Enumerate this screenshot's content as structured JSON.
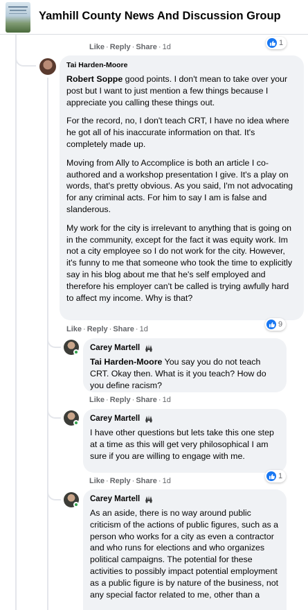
{
  "header": {
    "group_title": "Yamhill County News And Discussion Group"
  },
  "actions": {
    "like": "Like",
    "reply": "Reply",
    "share": "Share",
    "separator": "·"
  },
  "top_row": {
    "time": "1d",
    "reactions": "1"
  },
  "comment_main": {
    "author": "Tai Harden-Moore",
    "mention": "Robert Soppe",
    "paragraph_1": " good points. I don't mean to take over your post but I want to just mention a few things because I appreciate you calling these things out.",
    "paragraph_2": "For the record, no, I don't teach CRT, I have no idea where he got all of his inaccurate information on that. It's completely made up.",
    "paragraph_3": "Moving from Ally to Accomplice is both an article I co-authored and a workshop presentation I give. It's a play on words, that's pretty obvious. As you said, I'm not advocating for any criminal acts. For him to say I am is false and slanderous.",
    "paragraph_4": "My work for the city is irrelevant to anything that is going on in the community, except for the fact it was equity work. Im not a city employee so I do not work for the city. However, it's funny to me that someone who took the time to explicitly say in his blog about me that he's self employed and therefore his employer can't be called is trying awfully hard to affect my income. Why is that?",
    "time": "1d",
    "reactions": "9"
  },
  "reply_1": {
    "author": "Carey Martell",
    "mention": "Tai Harden-Moore",
    "text": " You say you do not teach CRT. Okay then. What is it you teach? How do you define racism?",
    "time": "1d"
  },
  "reply_2": {
    "author": "Carey Martell",
    "text": "I have other questions but lets take this one step at a time as this will get very philosophical I am sure if you are willing to engage with me.",
    "time": "1d",
    "reactions": "1"
  },
  "reply_3": {
    "author": "Carey Martell",
    "text": "As an aside, there is no way around public criticism of the actions of public figures, such as a person who works for a city as even a contractor and who runs for elections and who organizes political campaigns. The potential for these activities to possibly impact potential employment as a public figure is by nature of the business, not any special factor related to me, other than a"
  },
  "colors": {
    "bubble": "#f0f2f5",
    "meta_text": "#65676b",
    "like_blue": "#1877f2",
    "online_green": "#31a24c"
  },
  "icons": {
    "like": "like-thumb-icon",
    "badge": "top-fan-badge-icon"
  }
}
